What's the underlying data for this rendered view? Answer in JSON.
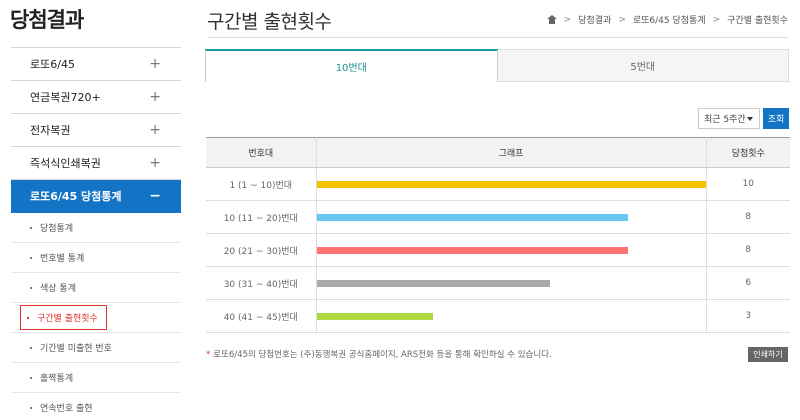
{
  "sidebar": {
    "title": "당첨결과",
    "menu": [
      {
        "label": "로또6/45",
        "sign": "+"
      },
      {
        "label": "연금복권720+",
        "sign": "+"
      },
      {
        "label": "전자복권",
        "sign": "+"
      },
      {
        "label": "즉석식인쇄복권",
        "sign": "+"
      },
      {
        "label": "로또6/45 당첨통계",
        "sign": "−"
      }
    ],
    "sub": [
      {
        "label": "당첨통계"
      },
      {
        "label": "번호별 통계"
      },
      {
        "label": "색상 통계"
      },
      {
        "label": "구간별 출현횟수"
      },
      {
        "label": "기간별 미출현 번호"
      },
      {
        "label": "홀짝통계"
      },
      {
        "label": "연속번호 출현"
      }
    ]
  },
  "header": {
    "title": "구간별 출현횟수",
    "breadcrumb": [
      "당첨결과",
      "로또6/45 당첨통계",
      "구간별 출현횟수"
    ]
  },
  "tabs": [
    {
      "label": "10번대"
    },
    {
      "label": "5번대"
    }
  ],
  "filter": {
    "selected": "최근 5주간",
    "search_label": "조회"
  },
  "table": {
    "headers": [
      "번호대",
      "그래프",
      "당첨횟수"
    ],
    "max": 10,
    "rows": [
      {
        "range": "1 (1 ~ 10)번대",
        "count": 10,
        "color": "#f5c200"
      },
      {
        "range": "10 (11 ~ 20)번대",
        "count": 8,
        "color": "#69c8f2"
      },
      {
        "range": "20 (21 ~ 30)번대",
        "count": 8,
        "color": "#ff7272"
      },
      {
        "range": "30 (31 ~ 40)번대",
        "count": 6,
        "color": "#aaaaaa"
      },
      {
        "range": "40 (41 ~ 45)번대",
        "count": 3,
        "color": "#b0d840"
      }
    ]
  },
  "note": {
    "star": "*",
    "text": "로또6/45의 당첨번호는 (주)동행복권 공식홈페이지, ARS전화 등을 통해 확인하실 수 있습니다."
  },
  "print_label": "인쇄하기",
  "colors": {
    "accent": "#1374c6",
    "highlight": "#e0332e",
    "tab_accent": "#1a9aa4"
  }
}
